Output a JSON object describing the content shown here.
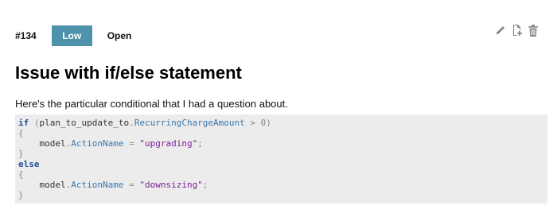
{
  "issue": {
    "id": "#134",
    "priority": "Low",
    "status": "Open",
    "title": "Issue with if/else statement",
    "description": "Here's the particular conditional that I had a question about."
  },
  "actions": [
    "edit-icon",
    "add-page-icon",
    "trash-icon"
  ],
  "colors": {
    "priority_badge": "#4e93ab",
    "code_bg": "#ececec"
  },
  "code": {
    "line1": {
      "kw": "if",
      "open": " (",
      "obj": "plan_to_update_to",
      "dot": ".",
      "prop": "RecurringChargeAmount",
      "rest": " > 0)"
    },
    "line2": "{",
    "line3": {
      "indent": "    ",
      "obj": "model",
      "dot": ".",
      "prop": "ActionName",
      "eq": " = ",
      "str": "\"upgrading\"",
      "end": ";"
    },
    "line4": "}",
    "line5": "else",
    "line6": "{",
    "line7": {
      "indent": "    ",
      "obj": "model",
      "dot": ".",
      "prop": "ActionName",
      "eq": " = ",
      "str": "\"downsizing\"",
      "end": ";"
    },
    "line8": "}"
  }
}
